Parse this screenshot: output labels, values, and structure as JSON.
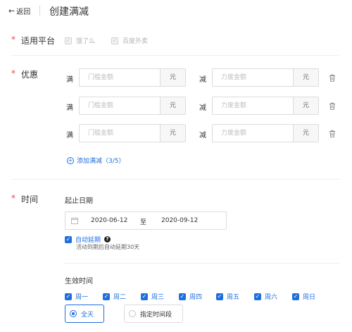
{
  "header": {
    "back_label": "返回",
    "title": "创建满减"
  },
  "platform": {
    "required_mark": "*",
    "label": "适用平台",
    "options": [
      {
        "label": "饿了么",
        "checked": true,
        "disabled": true
      },
      {
        "label": "百度外卖",
        "checked": true,
        "disabled": true
      }
    ]
  },
  "discount": {
    "required_mark": "*",
    "label": "优惠",
    "rows": [
      {
        "man": "满",
        "threshold_placeholder": "门槛金额",
        "threshold_unit": "元",
        "jian": "减",
        "amount_placeholder": "力度金额",
        "amount_unit": "元"
      },
      {
        "man": "满",
        "threshold_placeholder": "门槛金额",
        "threshold_unit": "元",
        "jian": "减",
        "amount_placeholder": "力度金额",
        "amount_unit": "元"
      },
      {
        "man": "满",
        "threshold_placeholder": "门槛金额",
        "threshold_unit": "元",
        "jian": "减",
        "amount_placeholder": "力度金额",
        "amount_unit": "元"
      }
    ],
    "add_label": "添加满减（3/5）"
  },
  "time": {
    "required_mark": "*",
    "label": "时间",
    "date_title": "起止日期",
    "start_date": "2020-06-12",
    "separator": "至",
    "end_date": "2020-09-12",
    "auto_extend": {
      "label": "自动延期",
      "checked": true,
      "note": "活动到期后自动延期30天"
    },
    "effective_title": "生效时间",
    "weekdays": [
      {
        "label": "周一",
        "checked": true
      },
      {
        "label": "周二",
        "checked": true
      },
      {
        "label": "周三",
        "checked": true
      },
      {
        "label": "周四",
        "checked": true
      },
      {
        "label": "周五",
        "checked": true
      },
      {
        "label": "周六",
        "checked": true
      },
      {
        "label": "周日",
        "checked": true
      }
    ],
    "modes": [
      {
        "label": "全天",
        "selected": true
      },
      {
        "label": "指定时间段",
        "selected": false
      }
    ]
  },
  "colors": {
    "accent": "#1f6fde",
    "required": "#e5484d",
    "border": "#dcdcdc"
  }
}
